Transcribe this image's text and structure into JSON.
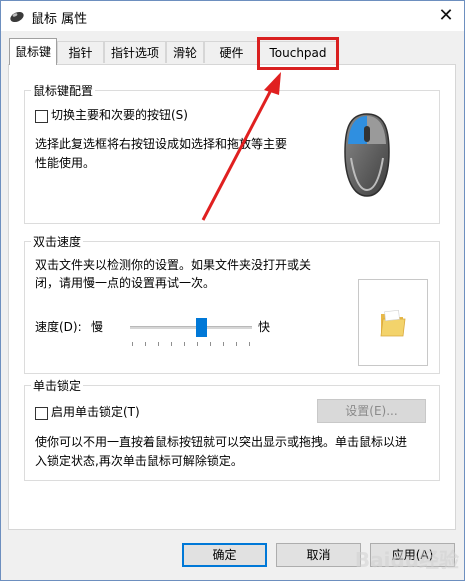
{
  "window": {
    "title": "鼠标 属性",
    "close_glyph": "✕"
  },
  "tabs": [
    {
      "label": "鼠标键",
      "active": true
    },
    {
      "label": "指针"
    },
    {
      "label": "指针选项"
    },
    {
      "label": "滑轮"
    },
    {
      "label": "硬件"
    },
    {
      "label": "Touchpad",
      "highlighted": true
    }
  ],
  "button_config": {
    "title": "鼠标键配置",
    "checkbox_label": "切换主要和次要的按钮(S)",
    "checked": false,
    "description_line1": "选择此复选框将右按钮设成如选择和拖放等主要",
    "description_line2": "性能使用。"
  },
  "double_click": {
    "title": "双击速度",
    "description_line1": "双击文件夹以检测你的设置。如果文件夹没打开或关",
    "description_line2": "闭，请用慢一点的设置再试一次。",
    "speed_label": "速度(D):",
    "slow_label": "慢",
    "fast_label": "快",
    "speed_level_percent": 58
  },
  "click_lock": {
    "title": "单击锁定",
    "checkbox_label": "启用单击锁定(T)",
    "checked": false,
    "settings_button": "设置(E)...",
    "description_line1": "使你可以不用一直按着鼠标按钮就可以突出显示或拖拽。单击鼠标以进",
    "description_line2": "入锁定状态,再次单击鼠标可解除锁定。"
  },
  "footer": {
    "ok": "确定",
    "cancel": "取消",
    "apply": "应用(A)"
  },
  "watermark": "Baidu经验",
  "colors": {
    "accent": "#0078d7",
    "highlight": "#d92020",
    "mouse_body": "#5a5a5a",
    "folder": "#f3d36b"
  },
  "icons": [
    "mouse-app-icon",
    "mouse-illustration-icon",
    "folder-icon",
    "close-icon",
    "red-arrow-annotation"
  ]
}
